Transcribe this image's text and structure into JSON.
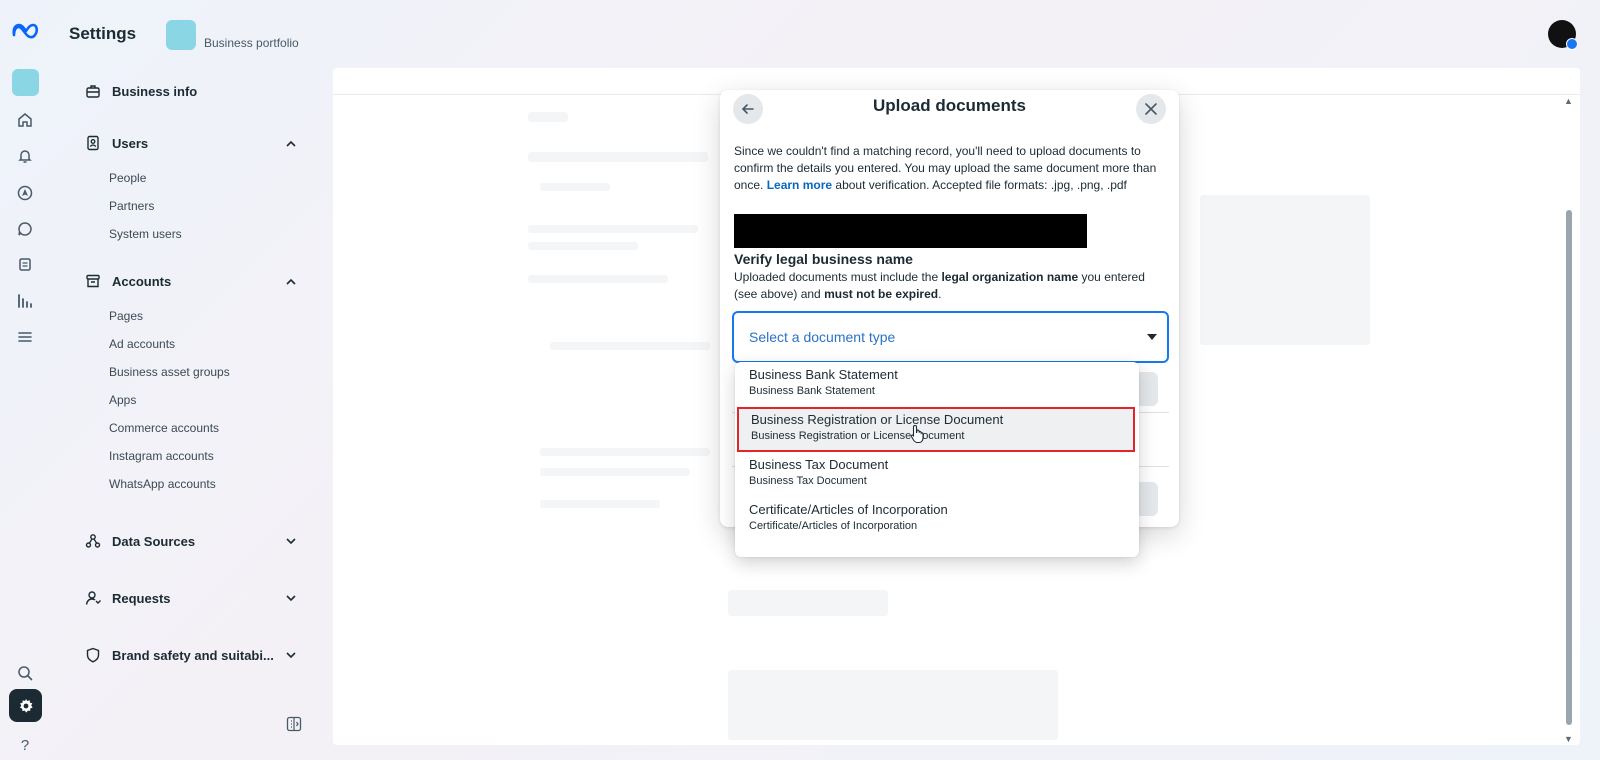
{
  "header": {
    "title": "Settings",
    "portfolio_label": "Business portfolio"
  },
  "sidebar": {
    "sections": [
      {
        "label": "Business info",
        "icon": "briefcase-icon"
      },
      {
        "label": "Users",
        "icon": "id-badge-icon",
        "expanded": true,
        "items": [
          "People",
          "Partners",
          "System users"
        ]
      },
      {
        "label": "Accounts",
        "icon": "archive-icon",
        "expanded": true,
        "items": [
          "Pages",
          "Ad accounts",
          "Business asset groups",
          "Apps",
          "Commerce accounts",
          "Instagram accounts",
          "WhatsApp accounts"
        ]
      },
      {
        "label": "Data Sources",
        "icon": "data-sources-icon",
        "expanded": false
      },
      {
        "label": "Requests",
        "icon": "person-request-icon",
        "expanded": false
      },
      {
        "label": "Brand safety and suitabi...",
        "icon": "shield-icon",
        "expanded": false
      }
    ]
  },
  "modal": {
    "title": "Upload documents",
    "desc_part1": "Since we couldn't find a matching record, you'll need to upload documents to confirm the details you entered. You may upload the same document more than once. ",
    "desc_link": "Learn more",
    "desc_part2": " about verification. Accepted file formats: .jpg, .png, .pdf",
    "verify_title": "Verify legal business name",
    "verify_desc_1": "Uploaded documents must include the ",
    "verify_desc_bold1": "legal organization name",
    "verify_desc_2": " you entered (see above) and ",
    "verify_desc_bold2": "must not be expired",
    "verify_desc_3": ".",
    "select_placeholder": "Select a document type"
  },
  "dropdown": {
    "highlighted_index": 1,
    "options": [
      {
        "title": "Business Bank Statement",
        "subtitle": "Business Bank Statement"
      },
      {
        "title": "Business Registration or License Document",
        "subtitle": "Business Registration or License Document"
      },
      {
        "title": "Business Tax Document",
        "subtitle": "Business Tax Document"
      },
      {
        "title": "Certificate/Articles of Incorporation",
        "subtitle": "Certificate/Articles of Incorporation"
      }
    ]
  },
  "colors": {
    "brand_blue": "#1877f2",
    "highlight_red": "#e0262b",
    "avatar_teal": "#8bd6e4"
  }
}
